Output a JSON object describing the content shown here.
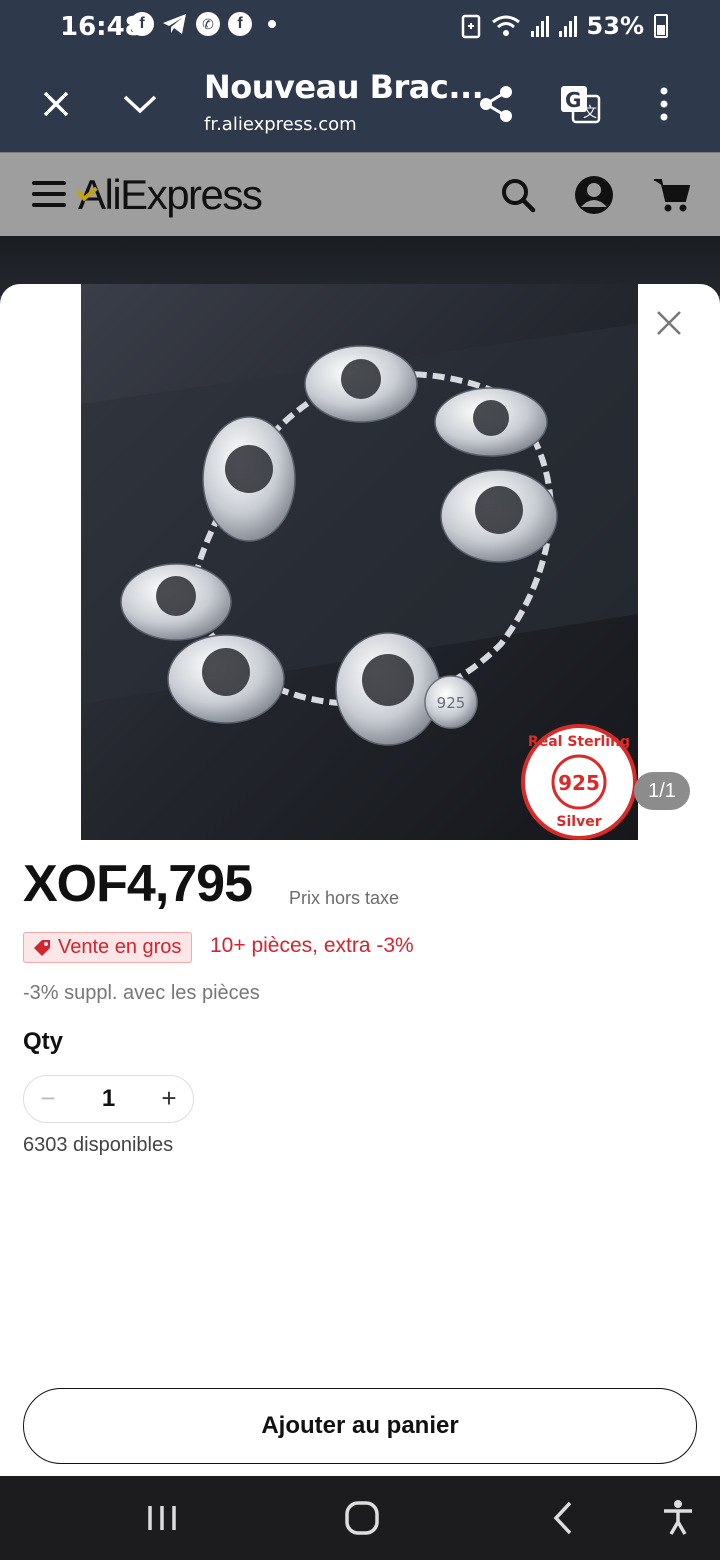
{
  "status_bar": {
    "time": "16:48",
    "battery": "53%",
    "app_icons": [
      "facebook-icon",
      "telegram-icon",
      "whatsapp-icon",
      "facebook-icon"
    ]
  },
  "browser": {
    "title": "Nouveau Brac...",
    "url": "fr.aliexpress.com"
  },
  "header": {
    "logo": "AliExpress"
  },
  "product": {
    "image_counter": "1/1",
    "seal_text_top": "Real Sterling",
    "seal_number": "925",
    "seal_text_bottom": "Silver",
    "tag_text": "925",
    "price": "XOF4,795",
    "tax_note": "Prix hors taxe",
    "bulk_badge": "Vente en gros",
    "bulk_offer": "10+ pièces, extra -3%",
    "extra_note": "-3% suppl. avec les pièces",
    "qty_label": "Qty",
    "qty_value": "1",
    "minus_symbol": "−",
    "plus_symbol": "+",
    "stock": "6303 disponibles",
    "add_to_cart": "Ajouter au panier"
  },
  "colors": {
    "status_bar_bg": "#2e3a4b",
    "header_bg": "#9e9e9e",
    "accent_red": "#d4242f",
    "badge_bg": "#fde6e7"
  }
}
